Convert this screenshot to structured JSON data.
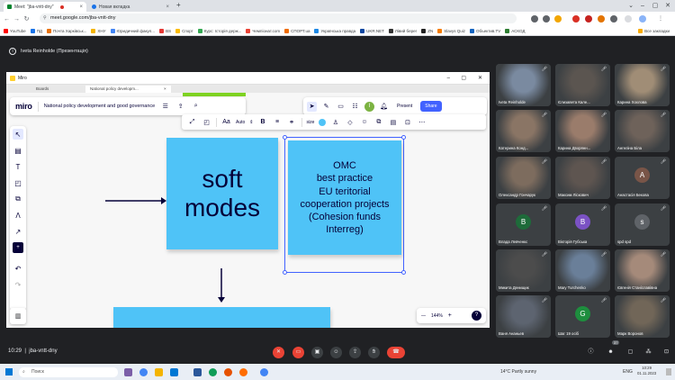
{
  "browser": {
    "tabs": [
      {
        "title": "Meet: \"jba-vntt-dny\"",
        "active": true
      },
      {
        "title": "Новая вкладка",
        "active": false
      }
    ],
    "url": "meet.google.com/jba-vntt-dny",
    "bookmarks": [
      "YouTube",
      "ПД",
      "Почта Харківськ...",
      "ХНУ",
      "Юридичний факул...",
      "BS",
      "Спорт",
      "Курс: Історія держ...",
      "Чемпіонат.com",
      "СПОРТ.ua",
      "Українська правда",
      "UKR.NET",
      "Лівий берег",
      "ZN",
      "Slavys Quiz",
      "Объектив.TV",
      "АСКОД"
    ],
    "all_bookmarks": "Все закладки"
  },
  "meet": {
    "presenter": "Iveta Reinholde (Презентація)",
    "meeting_code": "jba-vntt-dny",
    "time": "10:29",
    "participant_count": "37"
  },
  "miro": {
    "window_title": "Miro",
    "tabs": [
      "Boards",
      "National policy developm..."
    ],
    "logo": "miro",
    "board_name": "National policy development and good governance",
    "present": "Present",
    "share": "Share",
    "ctx_font": "Auto",
    "ctx_size": "size",
    "zoom": "144%",
    "help": "?",
    "note1_line1": "soft",
    "note1_line2": "modes",
    "note2_lines": [
      "OMC",
      "best practice",
      "EU teritorial",
      "cooperation projects",
      "(Cohesion funds",
      "Interreg)"
    ]
  },
  "participants": [
    {
      "name": "Iveta Reinholde",
      "avatar": "",
      "color": "#7a8aa0"
    },
    {
      "name": "Єлизавета Кале...",
      "avatar": "",
      "color": "#5b5550"
    },
    {
      "name": "Карина Хохлова",
      "avatar": "",
      "color": "#a08d76"
    },
    {
      "name": "Катерина Конд...",
      "avatar": "",
      "color": "#8a7565"
    },
    {
      "name": "Карина Дворянн...",
      "avatar": "",
      "color": "#9a7c6b"
    },
    {
      "name": "Ангеліна Біла",
      "avatar": "",
      "color": "#6e625a"
    },
    {
      "name": "Олександр Гончарук",
      "avatar": "",
      "color": "#7d6c5e"
    },
    {
      "name": "Максим Ліскович",
      "avatar": "",
      "color": "#5e5550"
    },
    {
      "name": "Анастасія Бекова",
      "avatar": "A",
      "color": "#795548"
    },
    {
      "name": "Влада Левченко",
      "avatar": "B",
      "color": "#1e6b3a"
    },
    {
      "name": "Вікторія Губська",
      "avatar": "B",
      "color": "#7b52c4"
    },
    {
      "name": "spd spd",
      "avatar": "s",
      "color": "#5f6368"
    },
    {
      "name": "Микита Денищик",
      "avatar": "",
      "color": "#4c4c4c"
    },
    {
      "name": "Mary Turchenko",
      "avatar": "",
      "color": "#6a7f99"
    },
    {
      "name": "Євгенія Станіславівна",
      "avatar": "",
      "color": "#a58a7a"
    },
    {
      "name": "Ваня Ананьев",
      "avatar": "",
      "color": "#5d6470"
    },
    {
      "name": "Шаг 19 осіб",
      "avatar": "G",
      "color": "#1e8e3e"
    },
    {
      "name": "Марк Воронов",
      "avatar": "",
      "color": "#716658"
    }
  ],
  "taskbar": {
    "search_placeholder": "Поиск",
    "weather": "14°C  Partly sunny",
    "lang": "ENG",
    "time": "10:29",
    "date": "01.11.2023"
  }
}
